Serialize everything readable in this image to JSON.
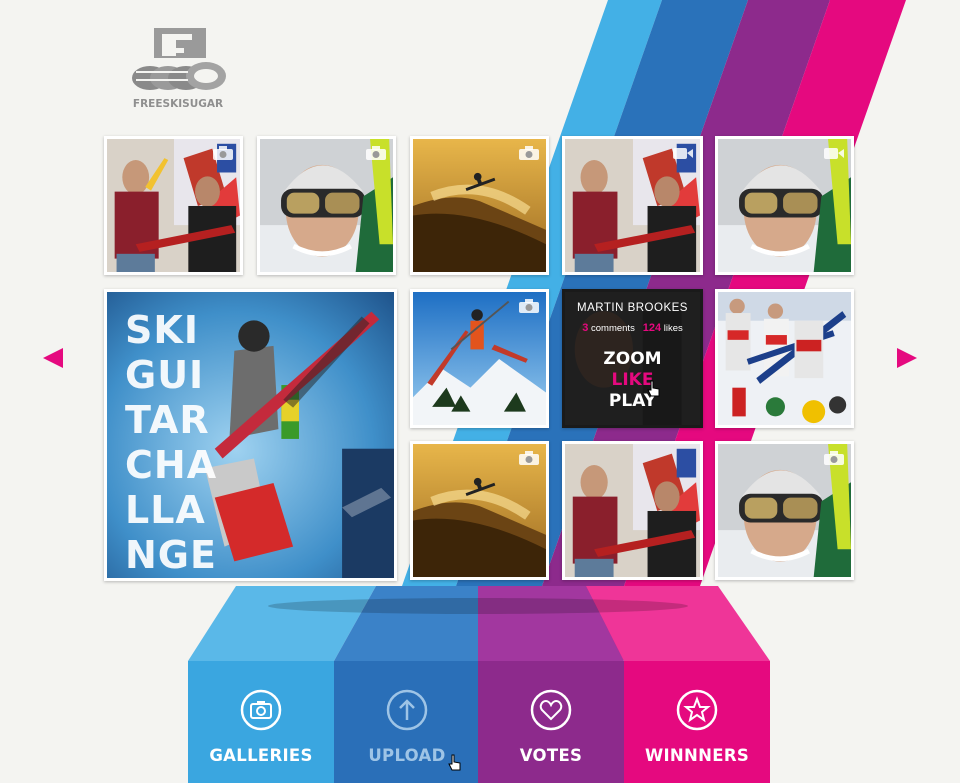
{
  "brand": {
    "name": "FREESKISUGAR",
    "colors": {
      "cyan": "#3aa6e0",
      "blue": "#2a6fb8",
      "purple": "#8d2a8c",
      "magenta": "#e5097f"
    }
  },
  "gallery": {
    "tiles": [
      {
        "id": "t1",
        "subject": "two-guys-guitars",
        "badge": "camera-icon"
      },
      {
        "id": "t2",
        "subject": "skier-portrait",
        "badge": "camera-icon"
      },
      {
        "id": "t3",
        "subject": "ski-jump-sunset",
        "badge": "camera-icon"
      },
      {
        "id": "t4",
        "subject": "two-guys-guitars",
        "badge": "video-icon"
      },
      {
        "id": "t5",
        "subject": "skier-portrait",
        "badge": "video-icon"
      },
      {
        "id": "t6",
        "subject": "ski-guitar-challenge",
        "badge": ""
      },
      {
        "id": "t7",
        "subject": "skier-jump-mountains",
        "badge": "camera-icon"
      },
      {
        "id": "t8",
        "subject": "overlay",
        "badge": ""
      },
      {
        "id": "t9",
        "subject": "ski-crowd",
        "badge": ""
      },
      {
        "id": "t10",
        "subject": "ski-jump-sunset",
        "badge": "camera-icon"
      },
      {
        "id": "t11",
        "subject": "two-guys-guitars",
        "badge": ""
      },
      {
        "id": "t12",
        "subject": "skier-portrait",
        "badge": "camera-icon"
      }
    ],
    "featured": {
      "title_lines": [
        "SKI",
        "GUI",
        "TAR",
        "CHA",
        "LLA",
        "NGE"
      ]
    },
    "hover": {
      "name": "MARTIN BROOKES",
      "comments_count": "3",
      "comments_label": "comments",
      "likes_count": "124",
      "likes_label": "likes",
      "actions": {
        "zoom": "ZOOM",
        "like": "LIKE",
        "play": "PLAY"
      }
    }
  },
  "nav": {
    "prev": "prev",
    "next": "next",
    "buttons": [
      {
        "label": "GALLERIES",
        "icon": "camera-icon",
        "color": "#3aa6e0"
      },
      {
        "label": "UPLOAD",
        "icon": "upload-arrow-icon",
        "color": "#2a6fb8"
      },
      {
        "label": "VOTES",
        "icon": "heart-icon",
        "color": "#8d2a8c"
      },
      {
        "label": "WINNNERS",
        "icon": "star-icon",
        "color": "#e5097f"
      }
    ]
  }
}
